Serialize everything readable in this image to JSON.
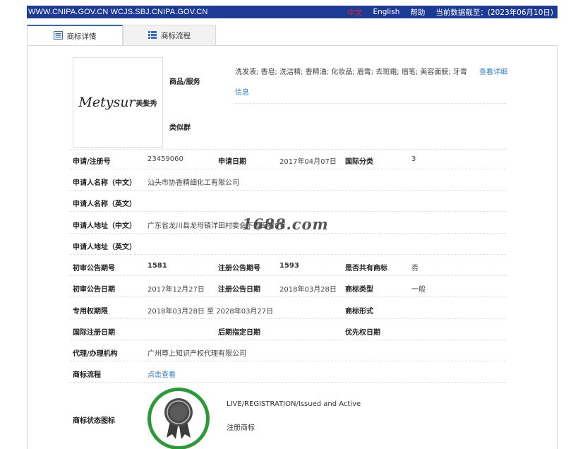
{
  "topbar": {
    "left": "WWW.CNIPA.GOV.CN WCJS.SBJ.CNIPA.GOV.CN",
    "lang_zh": "中文",
    "lang_en": "English",
    "help": "帮助",
    "data_date": "当前数据截至：(2023年06月10日)"
  },
  "tabs": [
    {
      "label": "商标详情",
      "icon": "document-icon",
      "active": true
    },
    {
      "label": "商标流程",
      "icon": "list-icon",
      "active": false
    }
  ],
  "logo": {
    "brand": "Metysur",
    "brand_cn": "美髪秀"
  },
  "goods": {
    "label": "商品/服务",
    "value": "洗发液; 香皂; 洗洁精; 香精油; 化妆品; 眉膏; 去斑霜; 眉笔; 美容面膜; 牙膏",
    "more_link_1": "查看详细",
    "more_link_2": "信息"
  },
  "similar_group": {
    "label": "类似群"
  },
  "rows": {
    "reg_no": {
      "label": "申请/注册号",
      "value": "23459060"
    },
    "apply_date": {
      "label": "申请日期",
      "value": "2017年04月07日"
    },
    "intl_class": {
      "label": "国际分类",
      "value": "3"
    },
    "applicant_cn": {
      "label": "申请人名称（中文）",
      "value": "汕头市协香精细化工有限公司"
    },
    "applicant_en": {
      "label": "申请人名称（英文）",
      "value": ""
    },
    "address_cn": {
      "label": "申请人地址（中文）",
      "value": "广东省龙川县龙母镇洋田村委会下陂田村8号"
    },
    "address_en": {
      "label": "申请人地址（英文）",
      "value": ""
    },
    "prelim_no": {
      "label": "初审公告期号",
      "value": "1581"
    },
    "reg_pub_no": {
      "label": "注册公告期号",
      "value": "1593"
    },
    "shared": {
      "label": "是否共有商标",
      "value": "否"
    },
    "prelim_date": {
      "label": "初审公告日期",
      "value": "2017年12月27日"
    },
    "reg_pub_date": {
      "label": "注册公告日期",
      "value": "2018年03月28日"
    },
    "mark_type": {
      "label": "商标类型",
      "value": "一般"
    },
    "exclusive": {
      "label": "专用权期限",
      "value": "2018年03月28日 至 2028年03月27日"
    },
    "mark_form": {
      "label": "商标形式",
      "value": ""
    },
    "intl_reg_date": {
      "label": "国际注册日期",
      "value": ""
    },
    "later_date": {
      "label": "后期指定日期",
      "value": ""
    },
    "priority_date": {
      "label": "优先权日期",
      "value": ""
    },
    "agent": {
      "label": "代理/办理机构",
      "value": "广州尊上知识产权代理有限公司"
    },
    "process": {
      "label": "商标流程",
      "value": "点击查看"
    },
    "status_icon": {
      "label": "商标状态图标"
    }
  },
  "status": {
    "en": "LIVE/REGISTRATION/Issued and Active",
    "cn": "注册商标"
  },
  "watermark": "1688.com",
  "colors": {
    "topbar": "#1e3a97",
    "link": "#2f7ec4",
    "badge_green": "#2d9a38",
    "zh_red": "#e62b1c"
  }
}
